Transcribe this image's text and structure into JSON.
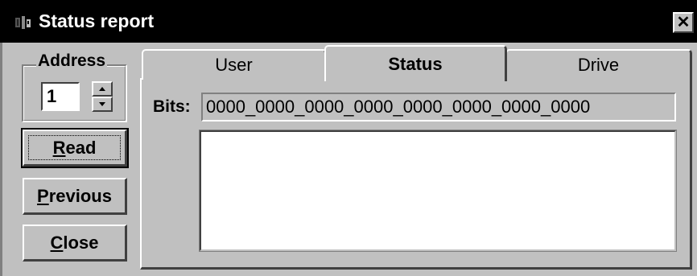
{
  "window": {
    "title": "Status report",
    "close_glyph": "✕",
    "icon": "app-icon"
  },
  "address": {
    "label": "Address",
    "value": "1"
  },
  "buttons": {
    "read": {
      "mnemonic": "R",
      "rest": "ead"
    },
    "previous": {
      "mnemonic": "P",
      "rest": "revious"
    },
    "close": {
      "mnemonic": "C",
      "rest": "lose"
    }
  },
  "tabs": [
    {
      "label": "User",
      "active": false
    },
    {
      "label": "Status",
      "active": true
    },
    {
      "label": "Drive",
      "active": false
    }
  ],
  "status": {
    "bits_label": "Bits:",
    "bits_value": "0000_0000_0000_0000_0000_0000_0000_0000"
  },
  "colors": {
    "face": "#c0c0c0",
    "titlebar": "#000000",
    "list_background": "#ffffff"
  }
}
